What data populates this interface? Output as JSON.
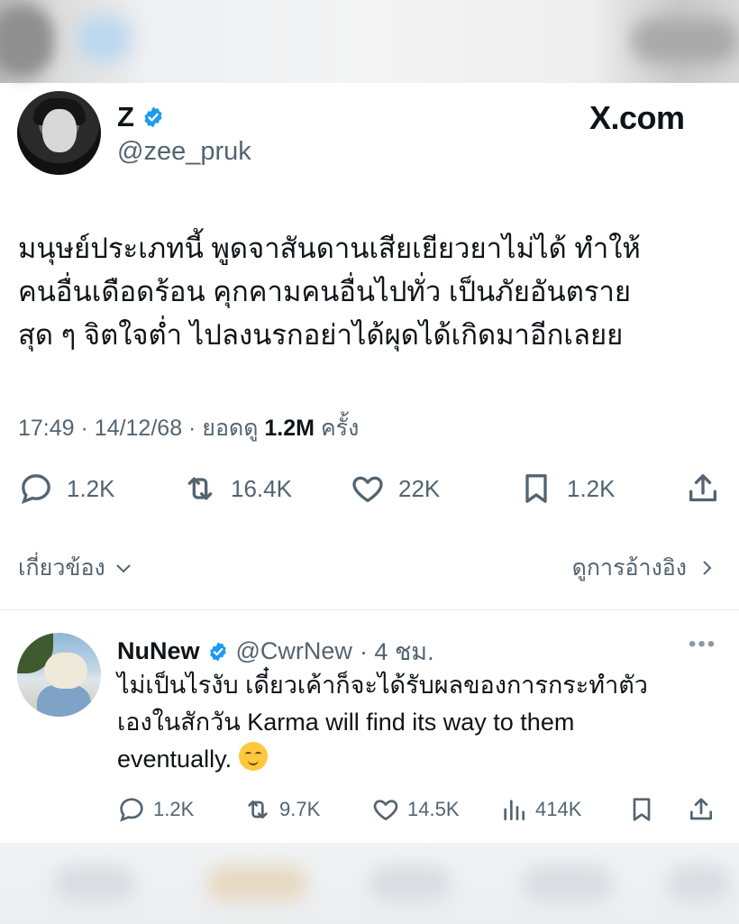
{
  "main_tweet": {
    "name": "Z",
    "handle": "@zee_pruk",
    "site": "X.com",
    "text_lines": [
      "มนุษย์ประเภทนี้ พูดจาสันดานเสียเยียวยาไม่ได้ ทำให้",
      "คนอื่นเดือดร้อน คุกคามคนอื่นไปทั่ว เป็นภัยอันตราย",
      "สุด ๆ จิตใจต่ำ ไปลงนรกอย่าได้ผุดได้เกิดมาอีกเลยย"
    ],
    "meta_prefix": "17:49 · 14/12/68 · ยอดดู",
    "views": "1.2M",
    "views_suffix": "ครั้ง",
    "actions": {
      "replies": "1.2K",
      "reposts": "16.4K",
      "likes": "22K",
      "bookmarks": "1.2K"
    },
    "related_label": "เกี่ยวข้อง",
    "quotes_label": "ดูการอ้างอิง"
  },
  "reply": {
    "name": "NuNew",
    "handle": "@CwrNew",
    "time": "· 4 ชม.",
    "text_lines": [
      "ไม่เป็นไรงับ เดี๋ยวเค้าก็จะได้รับผลของการกระทำตัว",
      "เองในสักวัน Karma will find its way to them",
      "eventually."
    ],
    "actions": {
      "replies": "1.2K",
      "reposts": "9.7K",
      "likes": "14.5K",
      "views": "414K"
    }
  },
  "colors": {
    "text": "#0f1419",
    "muted": "#536471",
    "verified": "#1d9bf0"
  },
  "icons": [
    "verified-badge-icon",
    "reply-icon",
    "repost-icon",
    "like-icon",
    "bookmark-icon",
    "share-icon",
    "views-icon",
    "more-icon",
    "chevron-down-icon",
    "chevron-right-icon"
  ]
}
